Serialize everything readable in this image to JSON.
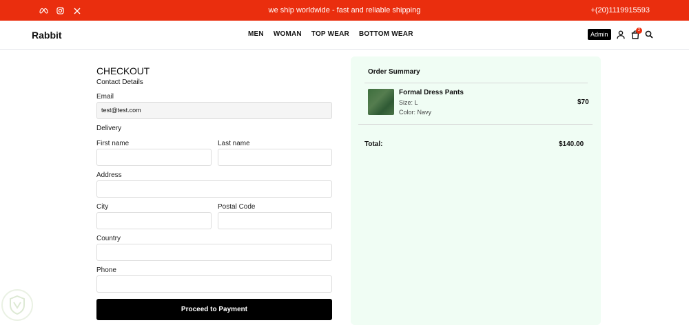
{
  "topbar": {
    "socials": [
      "meta-icon",
      "instagram-icon",
      "x-icon"
    ],
    "message": "we ship worldwide - fast and reliable shipping",
    "phone": "+(20)1119915593",
    "color": "#ea2e0e"
  },
  "header": {
    "logo": "Rabbit",
    "nav": [
      "MEN",
      "WOMAN",
      "TOP WEAR",
      "BOTTOM WEAR"
    ],
    "admin_label": "Admin",
    "cart_count": "2",
    "icons": [
      "user-icon",
      "shopping-bag-icon",
      "search-icon"
    ]
  },
  "checkout": {
    "title": "CHECKOUT",
    "contact_heading": "Contact Details",
    "email_label": "Email",
    "email_value": "test@test.com",
    "delivery_heading": "Delivery",
    "first_name_label": "First name",
    "last_name_label": "Last name",
    "address_label": "Address",
    "city_label": "City",
    "postal_code_label": "Postal Code",
    "country_label": "Country",
    "phone_label": "Phone",
    "submit_label": "Proceed to Payment"
  },
  "summary": {
    "title": "Order Summary",
    "items": [
      {
        "name": "Formal Dress Pants",
        "size": "Size: L",
        "color": "Color: Navy",
        "price": "$70"
      }
    ],
    "total_label": "Total:",
    "total_value": "$140.00",
    "background": "#f0fdf4"
  }
}
